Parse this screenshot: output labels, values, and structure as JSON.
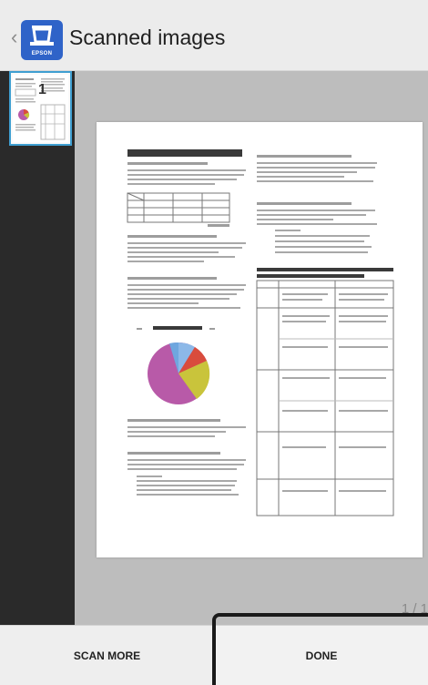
{
  "header": {
    "back_icon": "chevron-left-icon",
    "logo_icon": "scanner-app-icon",
    "logo_brand": "EPSON",
    "title": "Scanned images"
  },
  "sidebar": {
    "thumbnails": [
      {
        "number": "1",
        "selected": true
      }
    ]
  },
  "viewer": {
    "page_counter": "1 / 1"
  },
  "footer": {
    "scan_more_label": "SCAN MORE",
    "done_label": "DONE"
  },
  "colors": {
    "header_bg": "#ececec",
    "sidebar_bg": "#2a2a2a",
    "viewer_bg": "#bdbdbd",
    "thumbnail_border": "#3f9fd1",
    "logo_blue": "#2f63c8",
    "pie_slices": [
      "#8cb8e8",
      "#d94c3d",
      "#c9c43b",
      "#b85aa8"
    ]
  }
}
